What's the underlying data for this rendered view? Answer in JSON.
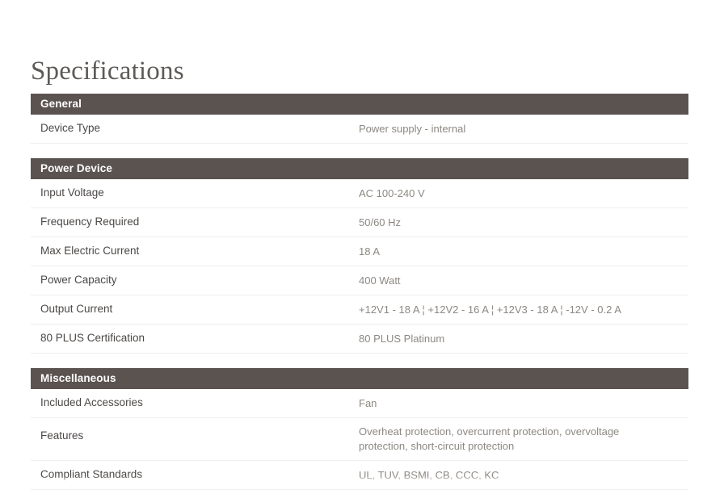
{
  "page": {
    "title": "Specifications",
    "theme": {
      "section_header_bg": "#5b5350",
      "section_header_text": "#ffffff",
      "label_color": "#4b4846",
      "value_color": "#8d8882",
      "divider_color": "#f0eeed",
      "page_bg": "#ffffff"
    }
  },
  "sections": [
    {
      "heading": "General",
      "rows": [
        {
          "label": "Device Type",
          "value": "Power supply - internal"
        }
      ]
    },
    {
      "heading": "Power Device",
      "rows": [
        {
          "label": "Input Voltage",
          "value": "AC 100-240 V"
        },
        {
          "label": "Frequency Required",
          "value": "50/60 Hz"
        },
        {
          "label": "Max Electric Current",
          "value": "18 A"
        },
        {
          "label": "Power Capacity",
          "value": "400 Watt"
        },
        {
          "label": "Output Current",
          "value": "+12V1 - 18 A ¦ +12V2 - 16 A ¦ +12V3 - 18 A ¦ -12V - 0.2 A"
        },
        {
          "label": "80 PLUS Certification",
          "value": "80 PLUS Platinum"
        }
      ]
    },
    {
      "heading": "Miscellaneous",
      "rows": [
        {
          "label": "Included Accessories",
          "value": "Fan"
        },
        {
          "label": "Features",
          "value": "Overheat protection, overcurrent protection, overvoltage protection, short-circuit protection"
        },
        {
          "label": "Compliant Standards",
          "value": "UL, TUV, BSMI, CB, CCC, KC"
        }
      ]
    }
  ]
}
